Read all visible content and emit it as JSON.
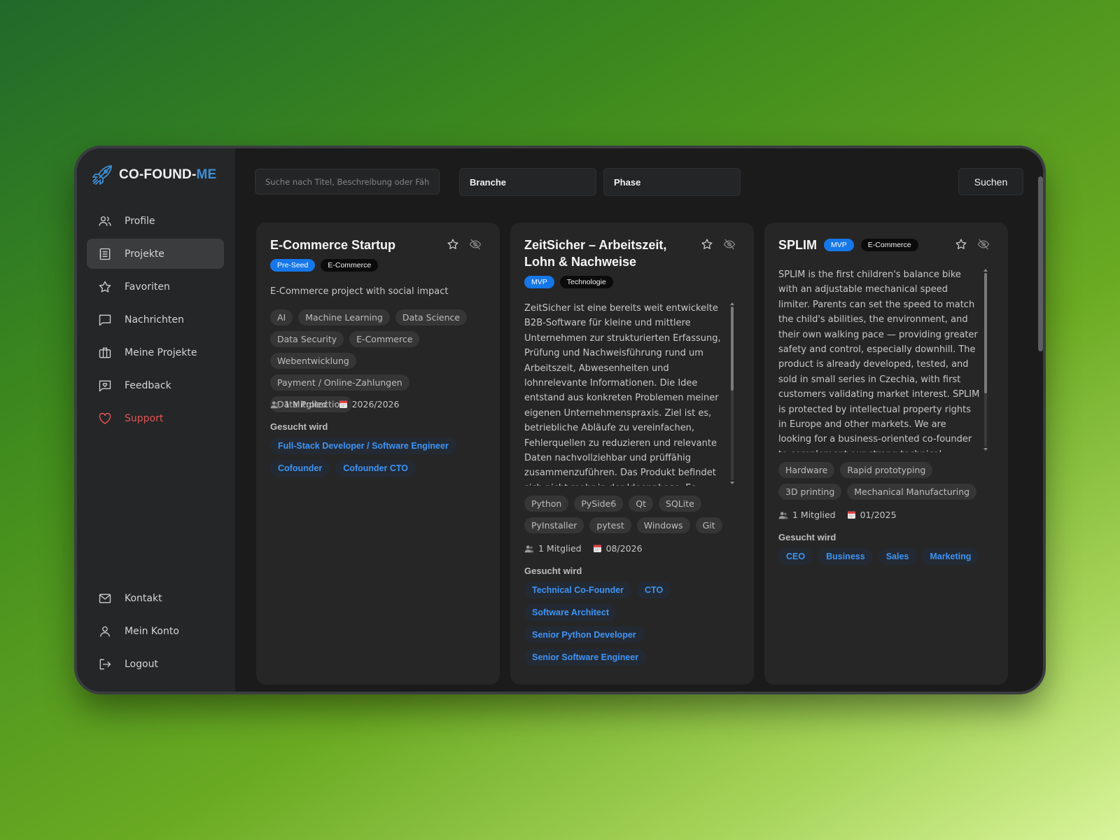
{
  "brand": {
    "name_main": "CO-FOUND-",
    "name_accent": "ME"
  },
  "nav": {
    "items": [
      {
        "label": "Profile"
      },
      {
        "label": "Projekte"
      },
      {
        "label": "Favoriten"
      },
      {
        "label": "Nachrichten"
      },
      {
        "label": "Meine Projekte"
      },
      {
        "label": "Feedback"
      },
      {
        "label": "Support"
      }
    ],
    "bottom": [
      {
        "label": "Kontakt"
      },
      {
        "label": "Mein Konto"
      },
      {
        "label": "Logout"
      }
    ]
  },
  "filters": {
    "search_placeholder": "Suche nach Titel, Beschreibung oder Fähigkeiten",
    "search_value": "",
    "branche": "Branche",
    "phase": "Phase",
    "submit_label": "Suchen"
  },
  "cards": [
    {
      "title": "E-Commerce Startup",
      "phase": "Pre-Seed",
      "branch": "E-Commerce",
      "description": "E-Commerce project with social impact",
      "skills": [
        "AI",
        "Machine Learning",
        "Data Science",
        "Data Security",
        "E-Commerce",
        "Webentwicklung",
        "Payment / Online-Zahlungen",
        "Data Protection"
      ],
      "members": "1 Mitglied",
      "date": "2026/2026",
      "wanted_label": "Gesucht wird",
      "roles": [
        "Full-Stack Developer / Software Engineer",
        "Cofounder",
        "Cofounder CTO"
      ]
    },
    {
      "title": "ZeitSicher – Arbeitszeit, Lohn & Nachweise",
      "phase": "MVP",
      "branch": "Technologie",
      "description": "ZeitSicher ist eine bereits weit entwickelte B2B-Software für kleine und mittlere Unternehmen zur strukturierten Erfassung, Prüfung und Nachweisführung rund um Arbeitszeit, Abwesenheiten und lohnrelevante Informationen. Die Idee entstand aus konkreten Problemen meiner eigenen Unternehmenspraxis. Ziel ist es, betriebliche Abläufe zu vereinfachen, Fehlerquellen zu reduzieren und relevante Daten nachvollziehbar und prüffähig zusammenzuführen. Das Produkt befindet sich nicht mehr in der Ideenphase. Es existiert",
      "skills": [
        "Python",
        "PySide6",
        "Qt",
        "SQLite",
        "PyInstaller",
        "pytest",
        "Windows",
        "Git"
      ],
      "members": "1 Mitglied",
      "date": "08/2026",
      "wanted_label": "Gesucht wird",
      "roles": [
        "Technical Co-Founder",
        "CTO",
        "Software Architect",
        "Senior Python Developer",
        "Senior Software Engineer"
      ]
    },
    {
      "title": "SPLIM",
      "phase": "MVP",
      "branch": "E-Commerce",
      "description": "SPLIM is the first children's balance bike with an adjustable mechanical speed limiter. Parents can set the speed to match the child's abilities, the environment, and their own walking pace — providing greater safety and control, especially downhill. The product is already developed, tested, and sold in small series in Czechia, with first customers validating market interest. SPLIM is protected by intellectual property rights in Europe and other markets. We are looking for a business-oriented co-founder to complement our strong technical background and build a well",
      "skills": [
        "Hardware",
        "Rapid prototyping",
        "3D printing",
        "Mechanical Manufacturing"
      ],
      "members": "1 Mitglied",
      "date": "01/2025",
      "wanted_label": "Gesucht wird",
      "roles": [
        "CEO",
        "Business",
        "Sales",
        "Marketing"
      ]
    }
  ],
  "colors": {
    "accent": "#1677e8",
    "brand_accent": "#3d8fd6",
    "support": "#e05555",
    "role_text": "#3f94f5"
  }
}
